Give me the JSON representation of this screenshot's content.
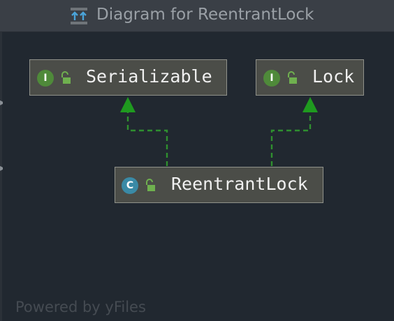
{
  "window": {
    "title": "Diagram for ReentrantLock",
    "title_icon": "class-hierarchy-icon"
  },
  "nodes": {
    "serializable": {
      "kind": "I",
      "kind_icon": "interface-icon",
      "access_icon": "public-lock-icon",
      "label": "Serializable"
    },
    "lock": {
      "kind": "I",
      "kind_icon": "interface-icon",
      "access_icon": "public-lock-icon",
      "label": "Lock"
    },
    "reentrantlock": {
      "kind": "C",
      "kind_icon": "class-icon",
      "access_icon": "public-lock-icon",
      "label": "ReentrantLock"
    }
  },
  "edges": [
    {
      "from": "ReentrantLock",
      "to": "Serializable",
      "relation": "implements",
      "style": "dashed"
    },
    {
      "from": "ReentrantLock",
      "to": "Lock",
      "relation": "implements",
      "style": "dashed"
    }
  ],
  "footer": {
    "text": "Powered by yFiles"
  },
  "colors": {
    "background": "#212830",
    "titlebar": "#3a3f46",
    "node_fill": "#4b4d48",
    "node_border": "#8f918a",
    "edge": "#2f8f2f",
    "interface_badge": "#4f8a3a",
    "class_badge": "#3a8aa6"
  }
}
